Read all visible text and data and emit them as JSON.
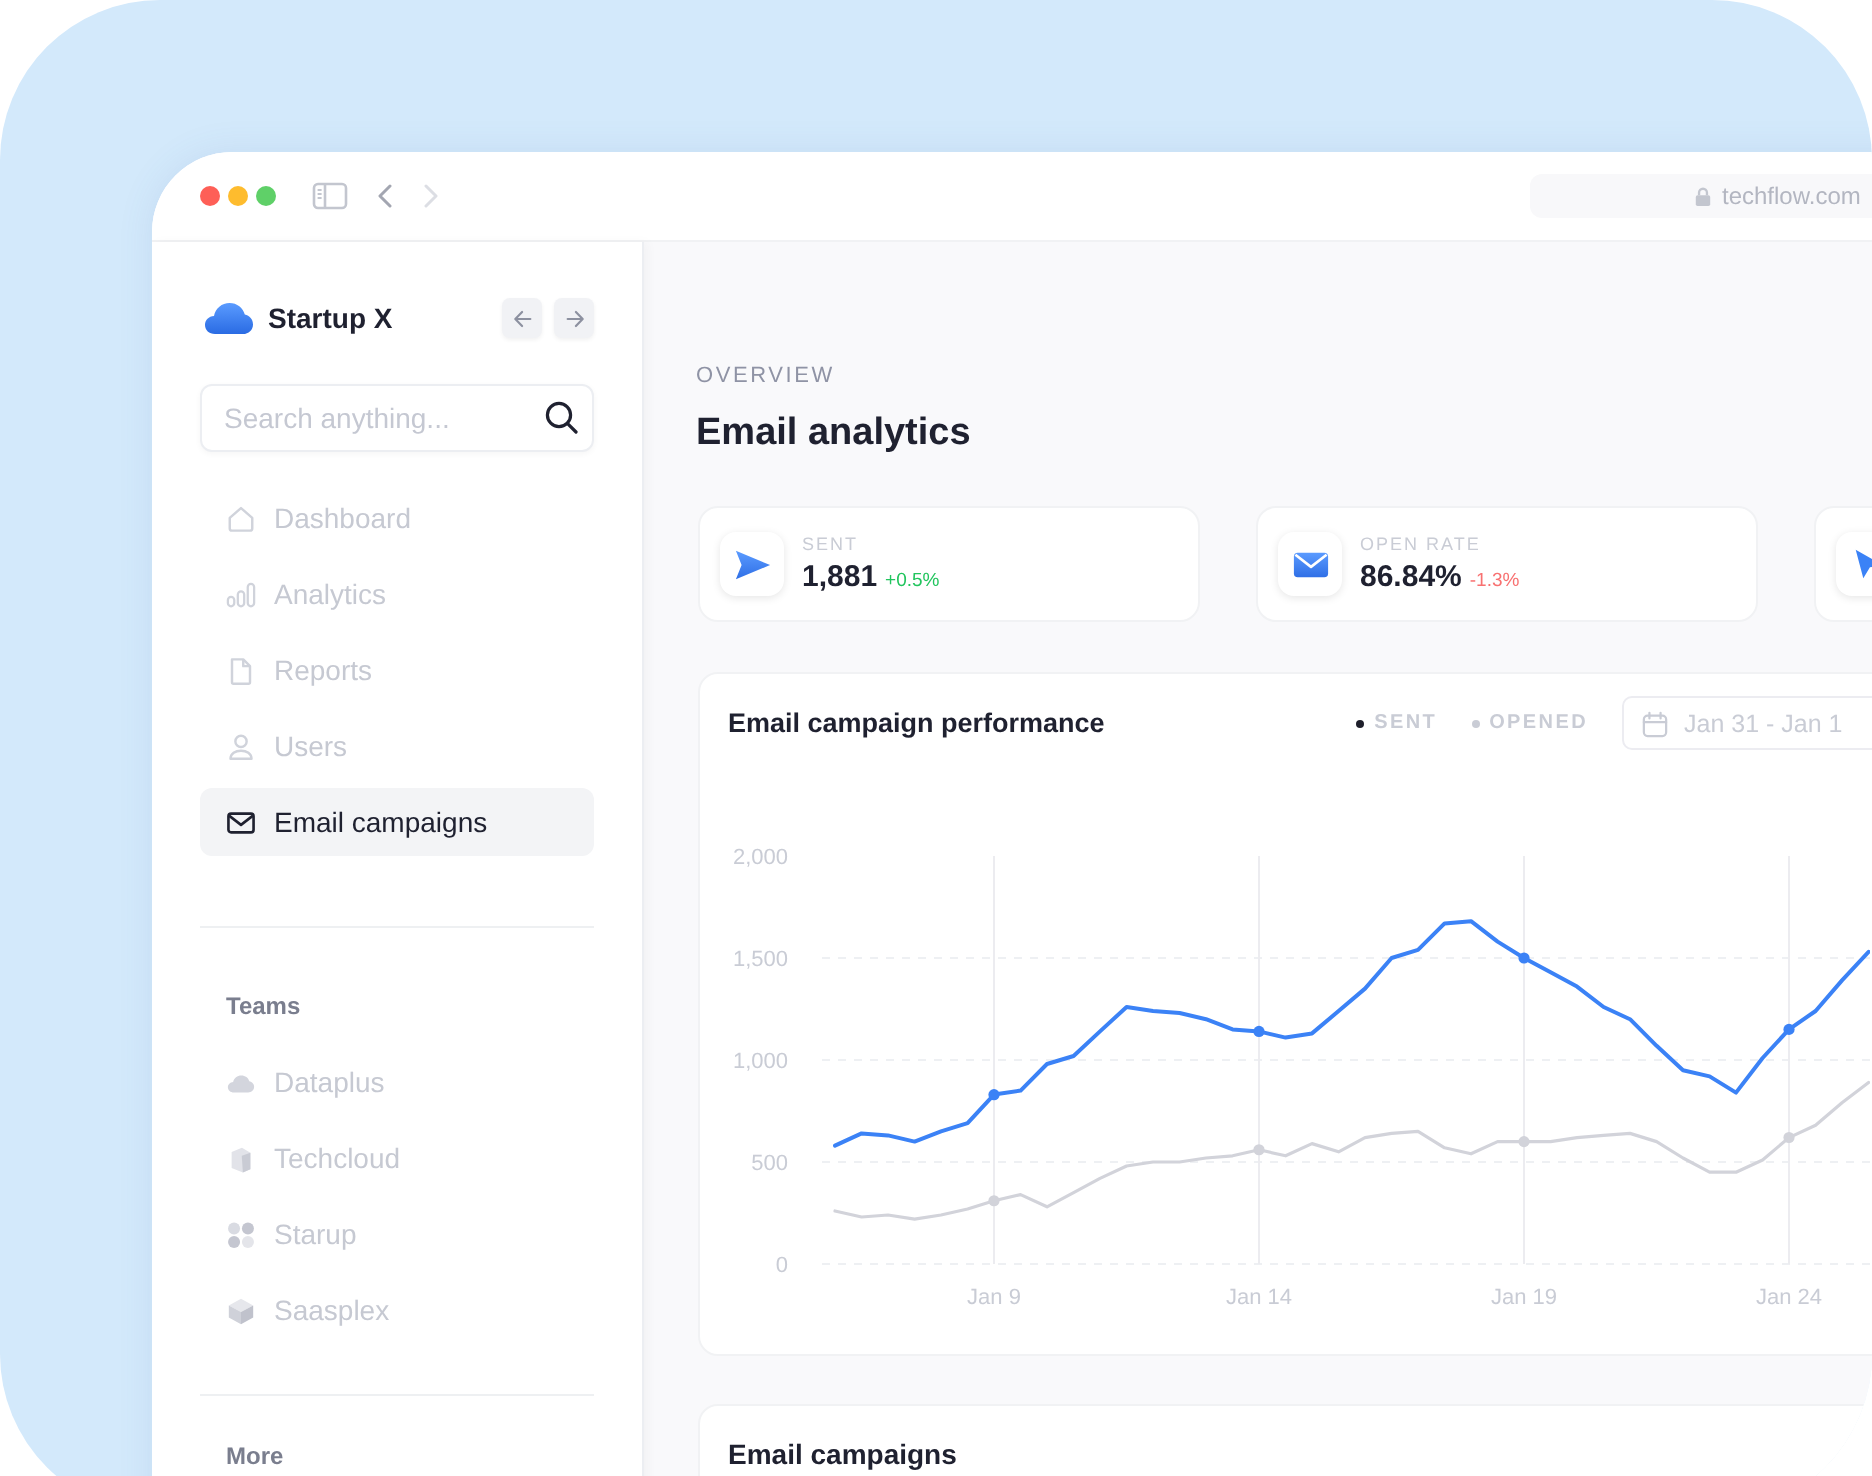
{
  "browser": {
    "back_disabled": false,
    "forward_disabled": true,
    "url": "techflow.com"
  },
  "sidebar": {
    "brand": "Startup X",
    "search": {
      "placeholder": "Search anything..."
    },
    "nav": [
      {
        "kind": "home",
        "label": "Dashboard",
        "selected": false
      },
      {
        "kind": "bars",
        "label": "Analytics",
        "selected": false
      },
      {
        "kind": "file",
        "label": "Reports",
        "selected": false
      },
      {
        "kind": "user",
        "label": "Users",
        "selected": false
      },
      {
        "kind": "mail",
        "label": "Email campaigns",
        "selected": true
      }
    ],
    "teams_heading": "Teams",
    "teams": [
      {
        "kind": "cloud",
        "label": "Dataplus",
        "selected": false
      },
      {
        "kind": "box",
        "label": "Techcloud",
        "selected": false
      },
      {
        "kind": "dots",
        "label": "Starup",
        "selected": false
      },
      {
        "kind": "cube",
        "label": "Saasplex",
        "selected": false
      }
    ],
    "more_heading": "More"
  },
  "main": {
    "overline": "OVERVIEW",
    "title": "Email analytics",
    "stats": [
      {
        "kind": "send",
        "label": "SENT",
        "value": "1,881",
        "change": "+0.5%",
        "negative": false
      },
      {
        "kind": "mail",
        "label": "OPEN RATE",
        "value": "86.84%",
        "change": "-1.3%",
        "negative": true
      },
      {
        "kind": "pointer"
      }
    ],
    "performance": {
      "title": "Email campaign performance",
      "legend": [
        {
          "color": "#1e1f2b"
        },
        {
          "color": "#c9ccd5"
        }
      ],
      "date_range": "Jan 31 - Jan 1",
      "chart_data": {
        "type": "line",
        "grid": true,
        "categories": [
          null,
          null,
          null,
          null,
          null,
          null,
          "Jan 9",
          null,
          null,
          null,
          null,
          null,
          null,
          null,
          null,
          null,
          "Jan 14",
          null,
          null,
          null,
          null,
          null,
          null,
          null,
          null,
          null,
          "Jan 19",
          null,
          null,
          null,
          null,
          null,
          null,
          null,
          null,
          null,
          "Jan 24",
          null,
          null,
          null
        ],
        "series": [
          {
            "name": "SENT",
            "color": "#3b82f6",
            "values": [
              580,
              640,
              630,
              600,
              650,
              690,
              830,
              850,
              980,
              1020,
              1140,
              1260,
              1240,
              1230,
              1200,
              1150,
              1140,
              1110,
              1130,
              1240,
              1350,
              1500,
              1540,
              1670,
              1680,
              1580,
              1500,
              1430,
              1360,
              1260,
              1200,
              1070,
              950,
              920,
              840,
              1010,
              1150,
              1240,
              1390,
              1530
            ]
          },
          {
            "name": "OPENED",
            "color": "#d2d3da",
            "values": [
              260,
              230,
              240,
              220,
              240,
              270,
              310,
              340,
              280,
              350,
              420,
              480,
              500,
              500,
              520,
              530,
              560,
              530,
              590,
              550,
              620,
              640,
              650,
              570,
              540,
              600,
              600,
              600,
              620,
              630,
              640,
              600,
              520,
              450,
              450,
              510,
              620,
              680,
              790,
              890
            ]
          }
        ],
        "ylim": [
          0,
          2000
        ],
        "yticks": [
          0,
          500,
          {
            "value": 1000,
            "label": "1,000"
          },
          {
            "value": 1500,
            "label": "1,500"
          },
          {
            "value": 2000,
            "label": "2,000"
          }
        ]
      }
    },
    "campaigns": {
      "title": "Email campaigns"
    }
  }
}
